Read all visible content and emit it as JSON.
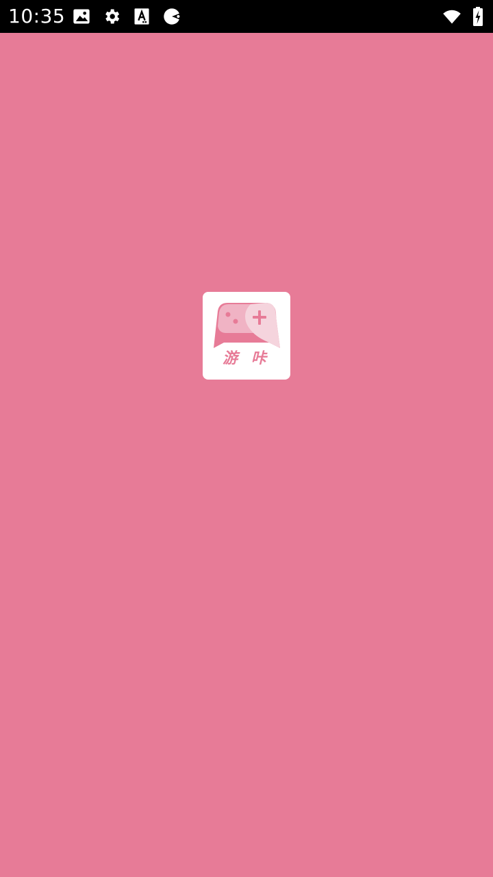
{
  "status_bar": {
    "time": "10:35",
    "left_icons": [
      "image-icon",
      "settings-gear-icon",
      "font-a-icon",
      "pacman-icon"
    ],
    "right_icons": [
      "wifi-icon",
      "battery-charging-icon"
    ]
  },
  "splash": {
    "background_color": "#e77b97",
    "logo_icon": "gamepad-logo-icon",
    "logo_text": "游 咔",
    "logo_text_color": "#e77b97"
  }
}
